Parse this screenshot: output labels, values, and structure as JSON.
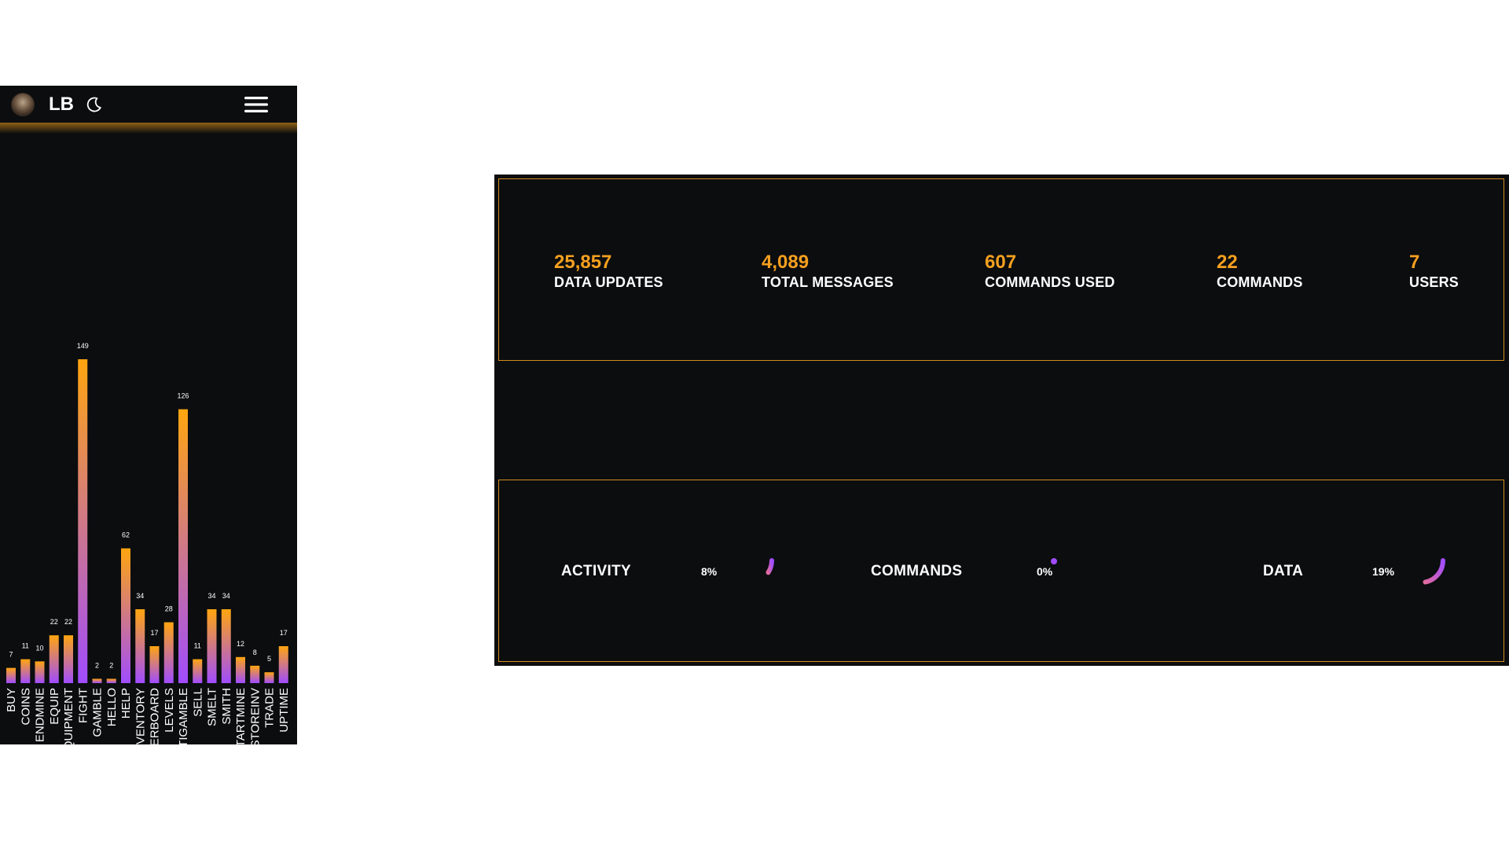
{
  "header": {
    "title": "LB",
    "avatar_icon": "avatar-image",
    "theme_icon": "moon-icon",
    "menu_icon": "hamburger-menu-icon"
  },
  "colors": {
    "accent": "#f5a01f",
    "bar_top": "#ffa50f",
    "bar_bottom": "#a04cff",
    "panel_bg": "#0b0d0f",
    "card_border": "#d28c1e"
  },
  "chart_data": {
    "type": "bar",
    "categories": [
      "BUY",
      "COINS",
      "ENDMINE",
      "EQUIP",
      "EQUIPMENT",
      "FIGHT",
      "GAMBLE",
      "HELLO",
      "HELP",
      "INVENTORY",
      "LEADERBOARD",
      "LEVELS",
      "MULTIGAMBLE",
      "SELL",
      "SMELT",
      "SMITH",
      "STARTMINE",
      "STOREINV",
      "TRADE",
      "UPTIME"
    ],
    "values": [
      7,
      11,
      10,
      22,
      22,
      149,
      2,
      2,
      62,
      34,
      17,
      28,
      126,
      11,
      34,
      34,
      12,
      8,
      5,
      17
    ],
    "title": "",
    "xlabel": "",
    "ylabel": "",
    "grid": false
  },
  "stats": [
    {
      "value": "25,857",
      "label": "DATA UPDATES"
    },
    {
      "value": "4,089",
      "label": "TOTAL MESSAGES"
    },
    {
      "value": "607",
      "label": "COMMANDS USED"
    },
    {
      "value": "22",
      "label": "COMMANDS"
    },
    {
      "value": "7",
      "label": "USERS"
    }
  ],
  "progress": [
    {
      "label": "ACTIVITY",
      "percent_text": "8%",
      "value": 0.08
    },
    {
      "label": "COMMANDS",
      "percent_text": "0%",
      "value": 0.0
    },
    {
      "label": "DATA",
      "percent_text": "19%",
      "value": 0.19
    }
  ]
}
